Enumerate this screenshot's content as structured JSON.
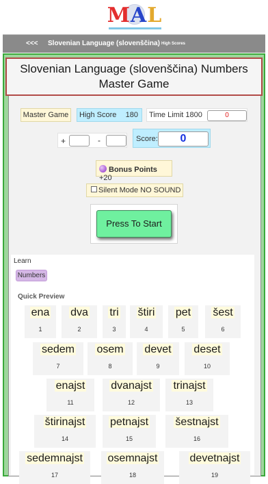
{
  "logo": {
    "m": "M",
    "a": "A",
    "l": "L"
  },
  "nav": {
    "back": "<<<",
    "title": "Slovenian Language (slovenščina)",
    "high_scores": "High Scores"
  },
  "game": {
    "title": "Slovenian Language (slovenščina) Numbers Master Game",
    "master_label": "Master Game",
    "high_score_label": "High Score",
    "high_score_value": "180",
    "time_limit_label": "Time Limit 1800",
    "time_value": "0",
    "plus": "+",
    "minus": "-",
    "score_label": "Score:",
    "score_value": "0",
    "bonus_label": "Bonus Points",
    "bonus_value": "+20",
    "silent_label": "Silent Mode NO SOUND",
    "start_label": "Press To Start"
  },
  "learn": {
    "label": "Learn",
    "tag": "Numbers",
    "preview_label": "Quick Preview"
  },
  "colors": {
    "accent_green": "#6ff09f",
    "frame_green": "#9ed69c",
    "title_border": "#b14a47",
    "score_blue": "#1531e0",
    "time_red": "#e21c1c"
  },
  "numbers": [
    {
      "word": "ena",
      "num": "1"
    },
    {
      "word": "dva",
      "num": "2"
    },
    {
      "word": "tri",
      "num": "3"
    },
    {
      "word": "štiri",
      "num": "4"
    },
    {
      "word": "pet",
      "num": "5"
    },
    {
      "word": "šest",
      "num": "6"
    },
    {
      "word": "sedem",
      "num": "7"
    },
    {
      "word": "osem",
      "num": "8"
    },
    {
      "word": "devet",
      "num": "9"
    },
    {
      "word": "deset",
      "num": "10"
    },
    {
      "word": "enajst",
      "num": "11"
    },
    {
      "word": "dvanajst",
      "num": "12"
    },
    {
      "word": "trinajst",
      "num": "13"
    },
    {
      "word": "štirinajst",
      "num": "14"
    },
    {
      "word": "petnajst",
      "num": "15"
    },
    {
      "word": "šestnajst",
      "num": "16"
    },
    {
      "word": "sedemnajst",
      "num": "17"
    },
    {
      "word": "osemnajst",
      "num": "18"
    },
    {
      "word": "devetnajst",
      "num": "19"
    }
  ]
}
